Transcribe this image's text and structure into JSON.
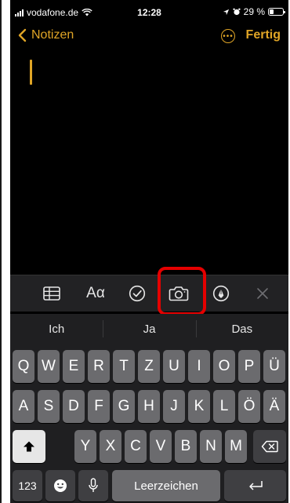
{
  "status": {
    "carrier": "vodafone.de",
    "time": "12:28",
    "battery": "29 %",
    "battery_level": 0.29
  },
  "nav": {
    "back_label": "Notizen",
    "done_label": "Fertig"
  },
  "toolbar": {
    "text_style_label": "Aα"
  },
  "suggestions": [
    "Ich",
    "Ja",
    "Das"
  ],
  "keyboard": {
    "row1": [
      "Q",
      "W",
      "E",
      "R",
      "T",
      "Z",
      "U",
      "I",
      "O",
      "P",
      "Ü"
    ],
    "row2": [
      "A",
      "S",
      "D",
      "F",
      "G",
      "H",
      "J",
      "K",
      "L",
      "Ö",
      "Ä"
    ],
    "row3": [
      "Y",
      "X",
      "C",
      "V",
      "B",
      "N",
      "M"
    ],
    "numbers_label": "123",
    "space_label": "Leerzeichen"
  },
  "colors": {
    "accent": "#e0a526",
    "highlight": "#e50000",
    "background": "#000000",
    "key": "#6b6b6e"
  }
}
